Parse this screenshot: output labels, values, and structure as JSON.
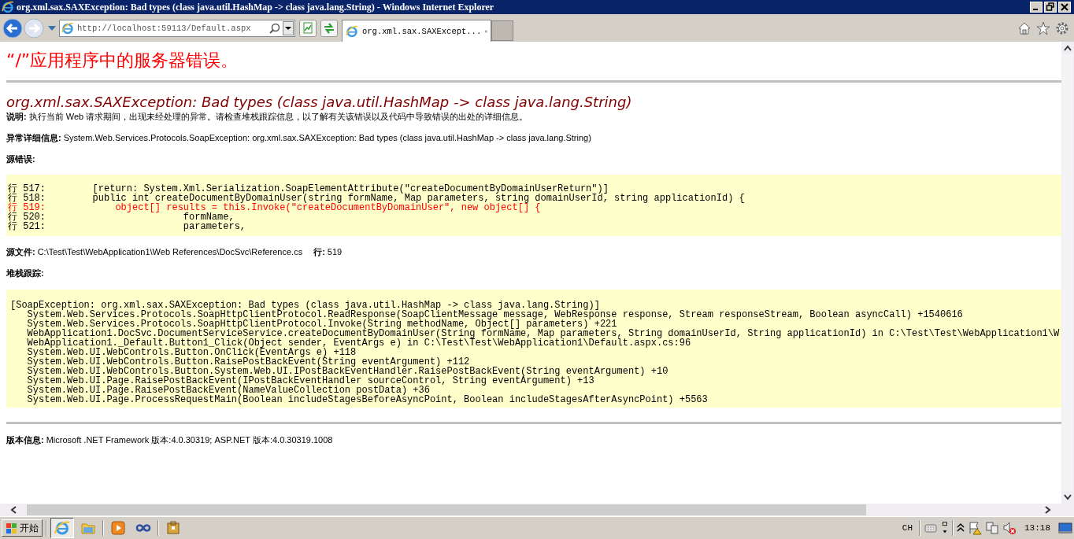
{
  "window": {
    "title": "org.xml.sax.SAXException: Bad types (class java.util.HashMap -> class java.lang.String) - Windows Internet Explorer"
  },
  "toolbar": {
    "address": "http://localhost:59113/Default.aspx",
    "tabs": [
      {
        "label": "org.xml.sax.SAXExcept...",
        "selected": true
      }
    ]
  },
  "page": {
    "heading": "“/”应用程序中的服务器错误。",
    "error_title": "org.xml.sax.SAXException: Bad types (class java.util.HashMap -> class java.lang.String)",
    "description": {
      "label": "说明:",
      "text": "执行当前 Web 请求期间，出现未经处理的异常。请检查堆栈跟踪信息，以了解有关该错误以及代码中导致错误的出处的详细信息。"
    },
    "exception_details": {
      "label": "异常详细信息:",
      "text": "System.Web.Services.Protocols.SoapException: org.xml.sax.SAXException: Bad types (class java.util.HashMap -> class java.lang.String)"
    },
    "source_error": {
      "label": "源错误:",
      "lines": [
        {
          "number": "行 517:",
          "code": "        [return: System.Xml.Serialization.SoapElementAttribute(\"createDocumentByDomainUserReturn\")]",
          "highlighted": false
        },
        {
          "number": "行 518:",
          "code": "        public int createDocumentByDomainUser(string formName, Map parameters, string domainUserId, string applicationId) {",
          "highlighted": false
        },
        {
          "number": "行 519:",
          "code": "            object[] results = this.Invoke(\"createDocumentByDomainUser\", new object[] {",
          "highlighted": true
        },
        {
          "number": "行 520:",
          "code": "                        formName,",
          "highlighted": false
        },
        {
          "number": "行 521:",
          "code": "                        parameters,",
          "highlighted": false
        }
      ]
    },
    "source_file": {
      "label": "源文件:",
      "path": "C:\\Test\\Test\\WebApplication1\\Web References\\DocSvc\\Reference.cs",
      "line_label": "行:",
      "line": "519"
    },
    "stack_trace": {
      "label": "堆栈跟踪:",
      "lines": [
        "[SoapException: org.xml.sax.SAXException: Bad types (class java.util.HashMap -> class java.lang.String)]",
        "   System.Web.Services.Protocols.SoapHttpClientProtocol.ReadResponse(SoapClientMessage message, WebResponse response, Stream responseStream, Boolean asyncCall) +1540616",
        "   System.Web.Services.Protocols.SoapHttpClientProtocol.Invoke(String methodName, Object[] parameters) +221",
        "   WebApplication1.DocSvc.DocumentServiceService.createDocumentByDomainUser(String formName, Map parameters, String domainUserId, String applicationId) in C:\\Test\\Test\\WebApplication1\\W",
        "   WebApplication1._Default.Button1_Click(Object sender, EventArgs e) in C:\\Test\\Test\\WebApplication1\\Default.aspx.cs:96",
        "   System.Web.UI.WebControls.Button.OnClick(EventArgs e) +118",
        "   System.Web.UI.WebControls.Button.RaisePostBackEvent(String eventArgument) +112",
        "   System.Web.UI.WebControls.Button.System.Web.UI.IPostBackEventHandler.RaisePostBackEvent(String eventArgument) +10",
        "   System.Web.UI.Page.RaisePostBackEvent(IPostBackEventHandler sourceControl, String eventArgument) +13",
        "   System.Web.UI.Page.RaisePostBackEvent(NameValueCollection postData) +36",
        "   System.Web.UI.Page.ProcessRequestMain(Boolean includeStagesBeforeAsyncPoint, Boolean includeStagesAfterAsyncPoint) +5563"
      ]
    },
    "version": {
      "label": "版本信息:",
      "text": "Microsoft .NET Framework 版本:4.0.30319; ASP.NET 版本:4.0.30319.1008"
    }
  },
  "taskbar": {
    "start": "开始",
    "language": "CH",
    "clock": "13:18"
  }
}
